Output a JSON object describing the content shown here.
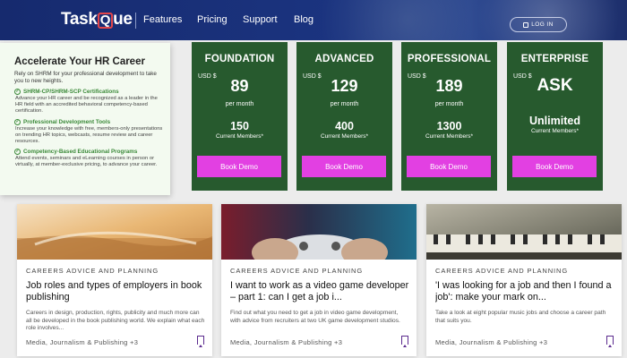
{
  "header": {
    "logo_text_1": "Task",
    "logo_text_2": "ue",
    "logo_q": "Q",
    "nav": [
      "Features",
      "Pricing",
      "Support",
      "Blog"
    ],
    "login_label": "LOG IN"
  },
  "promo": {
    "title": "Accelerate Your HR Career",
    "intro": "Rely on SHRM for your professional development to take you to new heights.",
    "items": [
      {
        "heading": "SHRM-CP/SHRM-SCP Certifications",
        "desc": "Advance your HR career and be recognized as a leader in the HR field with an accredited behavioral competency-based certification."
      },
      {
        "heading": "Professional Development Tools",
        "desc": "Increase your knowledge with free, members-only presentations on trending HR topics, webcasts, resume review and career resources."
      },
      {
        "heading": "Competency-Based Educational Programs",
        "desc": "Attend events, seminars and eLearning courses in person or virtually, at member-exclusive pricing, to advance your career."
      }
    ]
  },
  "plans": [
    {
      "name": "FOUNDATION",
      "currency": "USD $",
      "price": "89",
      "period": "per month",
      "members": "150",
      "members_label": "Current Members*",
      "button": "Book Demo"
    },
    {
      "name": "ADVANCED",
      "currency": "USD $",
      "price": "129",
      "period": "per month",
      "members": "400",
      "members_label": "Current Members*",
      "button": "Book Demo"
    },
    {
      "name": "PROFESSIONAL",
      "currency": "USD $",
      "price": "189",
      "period": "per month",
      "members": "1300",
      "members_label": "Current Members*",
      "button": "Book Demo"
    },
    {
      "name": "ENTERPRISE",
      "currency": "USD $",
      "price": "ASK",
      "period": "",
      "members": "Unlimited",
      "members_label": "Current Members*",
      "button": "Book Demo"
    }
  ],
  "articles": [
    {
      "category": "CAREERS ADVICE AND PLANNING",
      "title": "Job roles and types of employers in book publishing",
      "desc": "Careers in design, production, rights, publicity and much more can all be developed in the book publishing world. We explain what each role involves...",
      "tags": "Media, Journalism & Publishing +3"
    },
    {
      "category": "CAREERS ADVICE AND PLANNING",
      "title": "I want to work as a video game developer – part 1: can I get a job i...",
      "desc": "Find out what you need to get a job in video game development, with advice from recruiters at two UK game development studios.",
      "tags": "Media, Journalism & Publishing +3"
    },
    {
      "category": "CAREERS ADVICE AND PLANNING",
      "title": "'I was looking for a job and then I found a job': make your mark on...",
      "desc": "Take a look at eight popular music jobs and choose a career path that suits you.",
      "tags": "Media, Journalism & Publishing +3"
    }
  ]
}
